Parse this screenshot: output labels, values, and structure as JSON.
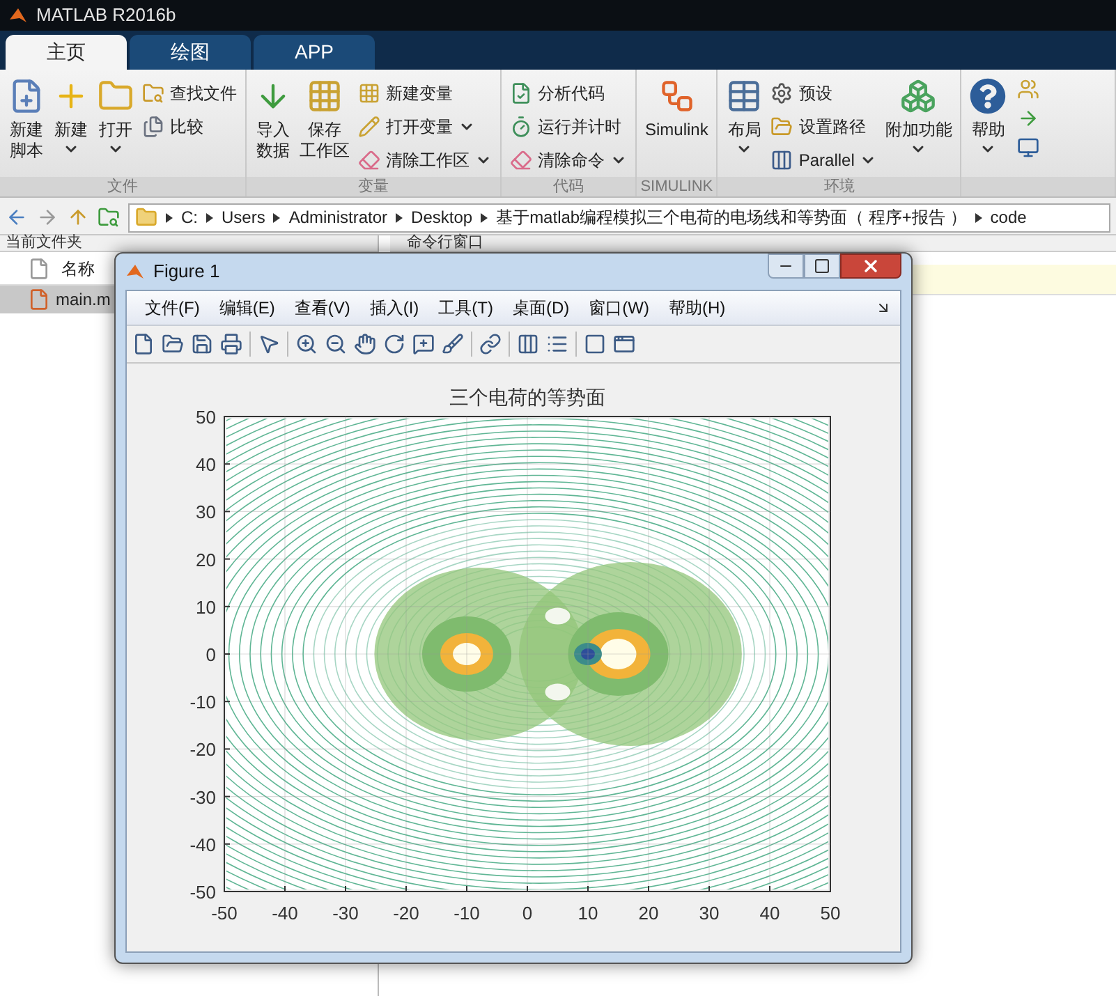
{
  "app": {
    "title": "MATLAB R2016b"
  },
  "tabs": [
    {
      "label": "主页",
      "selected": true
    },
    {
      "label": "绘图",
      "selected": false
    },
    {
      "label": "APP",
      "selected": false
    }
  ],
  "ribbon": [
    {
      "label": "文件",
      "items": [
        {
          "kind": "large",
          "lines": [
            "新建",
            "脚本"
          ],
          "dropdown": false
        },
        {
          "kind": "large",
          "lines": [
            "新建"
          ],
          "dropdown": true
        },
        {
          "kind": "large",
          "lines": [
            "打开"
          ],
          "dropdown": true
        },
        {
          "kind": "stack",
          "entries": [
            {
              "label": "查找文件",
              "dropdown": false
            },
            {
              "label": "比较",
              "dropdown": false
            }
          ]
        }
      ]
    },
    {
      "label": "变量",
      "items": [
        {
          "kind": "large",
          "lines": [
            "导入",
            "数据"
          ],
          "dropdown": false
        },
        {
          "kind": "large",
          "lines": [
            "保存",
            "工作区"
          ],
          "dropdown": false
        },
        {
          "kind": "stack",
          "entries": [
            {
              "label": "新建变量",
              "dropdown": false
            },
            {
              "label": "打开变量",
              "dropdown": true
            },
            {
              "label": "清除工作区",
              "dropdown": true
            }
          ]
        }
      ]
    },
    {
      "label": "代码",
      "items": [
        {
          "kind": "stack",
          "entries": [
            {
              "label": "分析代码",
              "dropdown": false
            },
            {
              "label": "运行并计时",
              "dropdown": false
            },
            {
              "label": "清除命令",
              "dropdown": true
            }
          ]
        }
      ]
    },
    {
      "label": "SIMULINK",
      "items": [
        {
          "kind": "large",
          "lines": [
            "Simulink"
          ],
          "dropdown": false
        }
      ]
    },
    {
      "label": "环境",
      "items": [
        {
          "kind": "large",
          "lines": [
            "布局"
          ],
          "dropdown": true
        },
        {
          "kind": "stack",
          "entries": [
            {
              "label": "预设",
              "dropdown": false
            },
            {
              "label": "设置路径",
              "dropdown": false
            },
            {
              "label": "Parallel",
              "dropdown": true
            }
          ]
        },
        {
          "kind": "large",
          "lines": [
            "附加功能"
          ],
          "dropdown": true
        }
      ]
    },
    {
      "items": [
        {
          "kind": "large",
          "lines": [
            "帮助"
          ],
          "dropdown": true
        },
        {
          "kind": "icons"
        }
      ]
    }
  ],
  "address": {
    "segments": [
      "C:",
      "Users",
      "Administrator",
      "Desktop",
      "基于matlab编程模拟三个电荷的电场线和等势面（ 程序+报告 ）",
      "code"
    ]
  },
  "current_folder": {
    "title": "当前文件夹",
    "column": "名称",
    "files": [
      {
        "name": "main.m",
        "selected": true
      }
    ]
  },
  "command_window": {
    "title": "命令行窗口"
  },
  "figure": {
    "title": "Figure 1",
    "menu": [
      "文件(F)",
      "编辑(E)",
      "查看(V)",
      "插入(I)",
      "工具(T)",
      "桌面(D)",
      "窗口(W)",
      "帮助(H)"
    ],
    "plot": {
      "title": "三个电荷的等势面",
      "xticks": [
        "-50",
        "-40",
        "-30",
        "-20",
        "-10",
        "0",
        "10",
        "20",
        "30",
        "40",
        "50"
      ],
      "yticks": [
        "50",
        "40",
        "30",
        "20",
        "10",
        "0",
        "-10",
        "-20",
        "-30",
        "-40",
        "-50"
      ]
    }
  }
}
